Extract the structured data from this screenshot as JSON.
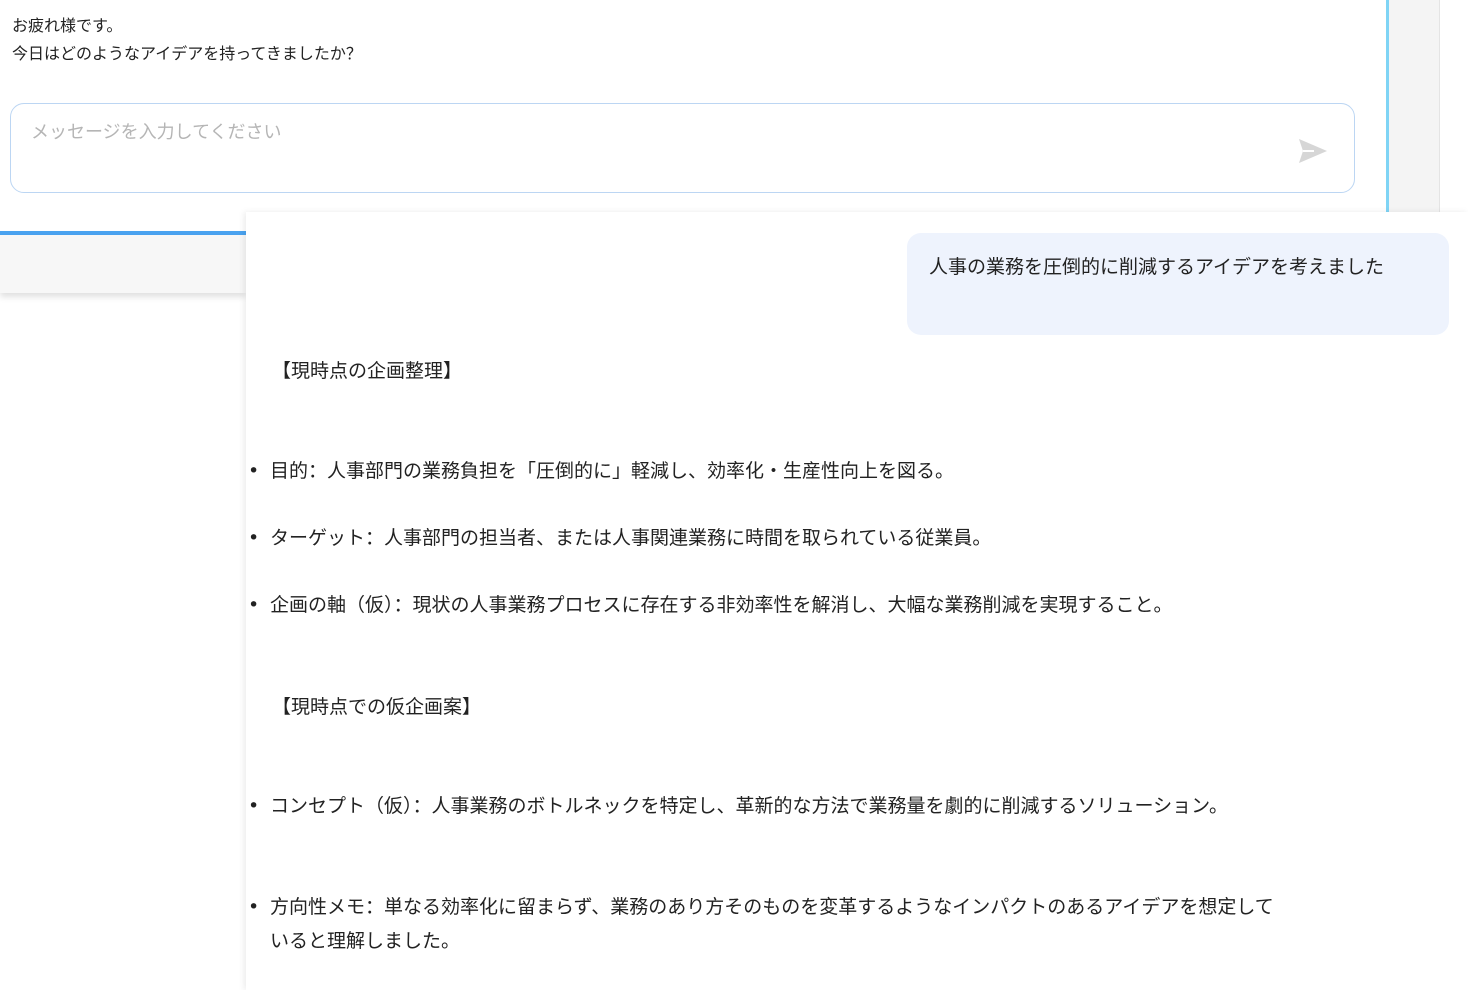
{
  "greeting": {
    "line1": "お疲れ様です。",
    "line2": "今日はどのようなアイデアを持ってきましたか？"
  },
  "input": {
    "placeholder": "メッセージを入力してください",
    "send_icon": "send-icon"
  },
  "chat": {
    "user_message": "人事の業務を圧倒的に削減するアイデアを考えました",
    "section1_title": "【現時点の企画整理】",
    "section1_bullets": [
      "目的：人事部門の業務負担を「圧倒的に」軽減し、効率化・生産性向上を図る。",
      "ターゲット：人事部門の担当者、または人事関連業務に時間を取られている従業員。",
      "企画の軸（仮）：現状の人事業務プロセスに存在する非効率性を解消し、大幅な業務削減を実現すること。"
    ],
    "section2_title": "【現時点での仮企画案】",
    "section2_bullets": [
      "コンセプト（仮）：人事業務のボトルネックを特定し、革新的な方法で業務量を劇的に削減するソリューション。",
      "方向性メモ：単なる効率化に留まらず、業務のあり方そのものを変革するようなインパクトのあるアイデアを想定していると理解しました。"
    ]
  },
  "colors": {
    "accent": "#4aa3f0",
    "user_bubble": "#eef3fd",
    "input_border": "#bcd6f3"
  }
}
